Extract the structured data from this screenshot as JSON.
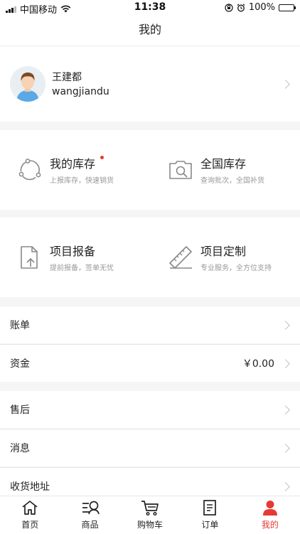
{
  "status_bar": {
    "carrier": "中国移动",
    "time": "11:38",
    "battery": "100%"
  },
  "nav": {
    "title": "我的"
  },
  "profile": {
    "name": "王建都",
    "username": "wangjiandu"
  },
  "grid": [
    {
      "title": "我的库存",
      "subtitle": "上报库存，快速销货",
      "icon": "recycle-icon",
      "badge": true
    },
    {
      "title": "全国库存",
      "subtitle": "查询批次，全国补货",
      "icon": "search-folder-icon"
    },
    {
      "title": "项目报备",
      "subtitle": "提前报备，签单无忧",
      "icon": "upload-doc-icon"
    },
    {
      "title": "项目定制",
      "subtitle": "专业服务，全方位支持",
      "icon": "ruler-icon"
    }
  ],
  "menu": {
    "bill": {
      "label": "账单"
    },
    "funds": {
      "label": "资金",
      "value": "￥0.00"
    },
    "aftersale": {
      "label": "售后"
    },
    "messages": {
      "label": "消息"
    },
    "address": {
      "label": "收货地址"
    }
  },
  "tabbar": {
    "tabs": [
      {
        "label": "首页",
        "icon": "home-icon"
      },
      {
        "label": "商品",
        "icon": "product-search-icon"
      },
      {
        "label": "购物车",
        "icon": "cart-icon"
      },
      {
        "label": "订单",
        "icon": "order-icon"
      },
      {
        "label": "我的",
        "icon": "person-icon",
        "active": true
      }
    ],
    "active_color": "#e53935"
  }
}
